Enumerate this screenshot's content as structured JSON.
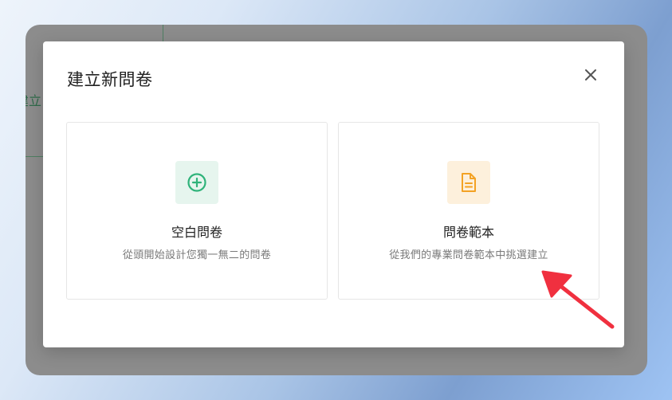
{
  "background": {
    "app_fragment_text": "建立"
  },
  "dialog": {
    "title": "建立新問卷",
    "close_icon": "close-icon",
    "cards": [
      {
        "id": "blank",
        "icon": "plus-circle-icon",
        "title": "空白問卷",
        "description": "從頭開始設計您獨一無二的問卷"
      },
      {
        "id": "template",
        "icon": "document-icon",
        "title": "問卷範本",
        "description": "從我們的專業問卷範本中挑選建立"
      }
    ]
  },
  "colors": {
    "green_accent": "#2fb37a",
    "orange_accent": "#f3a224",
    "annotation_arrow": "#f0303f"
  }
}
